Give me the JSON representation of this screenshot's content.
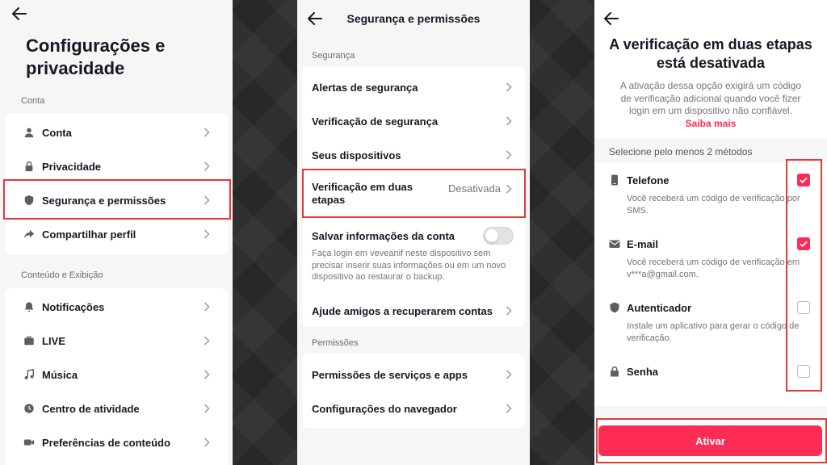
{
  "colors": {
    "accent": "#fe2c55",
    "highlight": "#e53935"
  },
  "panel1": {
    "title": "Configurações e privacidade",
    "section_account": "Conta",
    "account_items": [
      {
        "label": "Conta",
        "icon": "person-icon"
      },
      {
        "label": "Privacidade",
        "icon": "lock-icon"
      },
      {
        "label": "Segurança e permissões",
        "icon": "shield-icon"
      },
      {
        "label": "Compartilhar perfil",
        "icon": "share-icon"
      }
    ],
    "section_content": "Conteúdo e Exibição",
    "content_items": [
      {
        "label": "Notificações",
        "icon": "bell-icon"
      },
      {
        "label": "LIVE",
        "icon": "tv-icon"
      },
      {
        "label": "Música",
        "icon": "music-icon"
      },
      {
        "label": "Centro de atividade",
        "icon": "clock-icon"
      },
      {
        "label": "Preferências de conteúdo",
        "icon": "video-icon"
      }
    ]
  },
  "panel2": {
    "title": "Segurança e permissões",
    "section_security": "Segurança",
    "items": {
      "alerts": "Alertas de segurança",
      "check": "Verificação de segurança",
      "devices": "Seus dispositivos",
      "two_step": "Verificação em duas etapas",
      "two_step_status": "Desativada",
      "save_info": "Salvar informações da conta",
      "save_info_desc": "Faça login em veveanif neste dispositivo sem precisar inserir suas informações ou em um novo dispositivo ao restaurar o backup.",
      "recover": "Ajude amigos a recuperarem contas"
    },
    "section_permissions": "Permissões",
    "perm_items": {
      "services": "Permissões de serviços e apps",
      "browser": "Configurações do navegador"
    }
  },
  "panel3": {
    "title": "A verificação em duas etapas está desativada",
    "description": "A ativação dessa opção exigirá um código de verificação adicional quando você fizer login em um dispositivo não confiável.",
    "learn_more": "Saiba mais",
    "select_label": "Selecione pelo menos 2 métodos",
    "methods": [
      {
        "title": "Telefone",
        "desc": "Você receberá um código de verificação por SMS.",
        "checked": true,
        "icon": "phone-icon"
      },
      {
        "title": "E-mail",
        "desc": "Você receberá um código de verificação em v***a@gmail.com.",
        "checked": true,
        "icon": "mail-icon"
      },
      {
        "title": "Autenticador",
        "desc": "Instale um aplicativo para gerar o código de verificação.",
        "checked": false,
        "icon": "shield-icon"
      },
      {
        "title": "Senha",
        "desc": "",
        "checked": false,
        "icon": "lock-icon"
      }
    ],
    "button": "Ativar"
  }
}
